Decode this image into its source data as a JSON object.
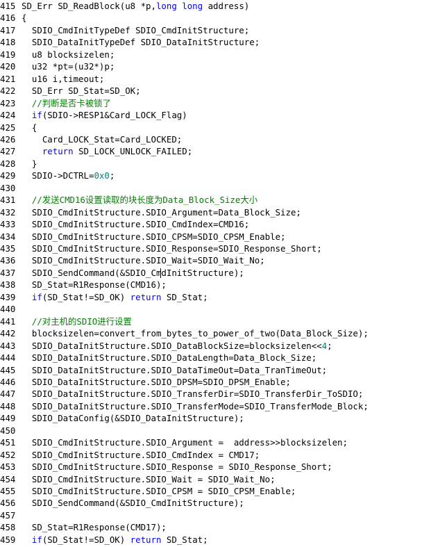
{
  "editor": {
    "lines": [
      {
        "no": "415",
        "parts": [
          {
            "t": "SD_Err SD_ReadBlock(u8 *p,"
          },
          {
            "t": "long long",
            "k": "kw"
          },
          {
            "t": " address)"
          }
        ]
      },
      {
        "no": "416",
        "parts": [
          {
            "t": "{"
          }
        ]
      },
      {
        "no": "417",
        "parts": [
          {
            "t": "  SDIO_CmdInitTypeDef SDIO_CmdInitStructure;"
          }
        ]
      },
      {
        "no": "418",
        "parts": [
          {
            "t": "  SDIO_DataInitTypeDef SDIO_DataInitStructure;"
          }
        ]
      },
      {
        "no": "419",
        "parts": [
          {
            "t": "  u8 blocksizelen;"
          }
        ]
      },
      {
        "no": "420",
        "parts": [
          {
            "t": "  u32 *pt=(u32*)p;"
          }
        ]
      },
      {
        "no": "421",
        "parts": [
          {
            "t": "  u16 i,timeout;"
          }
        ]
      },
      {
        "no": "422",
        "parts": [
          {
            "t": "  SD_Err SD_Stat=SD_OK;"
          }
        ]
      },
      {
        "no": "423",
        "parts": [
          {
            "t": "  //判断是否卡被锁了",
            "k": "cm"
          }
        ]
      },
      {
        "no": "424",
        "parts": [
          {
            "t": "  "
          },
          {
            "t": "if",
            "k": "kw"
          },
          {
            "t": "(SDIO->RESP1&Card_LOCK_Flag)"
          }
        ]
      },
      {
        "no": "425",
        "parts": [
          {
            "t": "  {"
          }
        ]
      },
      {
        "no": "426",
        "parts": [
          {
            "t": "    Card_LOCK_Stat=Card_LOCKED;"
          }
        ]
      },
      {
        "no": "427",
        "parts": [
          {
            "t": "    "
          },
          {
            "t": "return",
            "k": "kw"
          },
          {
            "t": " SD_LOCK_UNLOCK_FAILED;"
          }
        ]
      },
      {
        "no": "428",
        "parts": [
          {
            "t": "  }"
          }
        ]
      },
      {
        "no": "429",
        "parts": [
          {
            "t": "  SDIO->DCTRL="
          },
          {
            "t": "0x0",
            "k": "num"
          },
          {
            "t": ";"
          }
        ]
      },
      {
        "no": "430",
        "parts": []
      },
      {
        "no": "431",
        "parts": [
          {
            "t": "  //发送CMD16设置读取的块长度为Data_Block_Size大小",
            "k": "cm"
          }
        ]
      },
      {
        "no": "432",
        "parts": [
          {
            "t": "  SDIO_CmdInitStructure.SDIO_Argument=Data_Block_Size;"
          }
        ]
      },
      {
        "no": "433",
        "parts": [
          {
            "t": "  SDIO_CmdInitStructure.SDIO_CmdIndex=CMD16;"
          }
        ]
      },
      {
        "no": "434",
        "parts": [
          {
            "t": "  SDIO_CmdInitStructure.SDIO_CPSM=SDIO_CPSM_Enable;"
          }
        ]
      },
      {
        "no": "435",
        "parts": [
          {
            "t": "  SDIO_CmdInitStructure.SDIO_Response=SDIO_Response_Short;"
          }
        ]
      },
      {
        "no": "436",
        "parts": [
          {
            "t": "  SDIO_CmdInitStructure.SDIO_Wait=SDIO_Wait_No;"
          }
        ]
      },
      {
        "no": "437",
        "parts": [
          {
            "t": "  SDIO_SendCommand(&SDIO_CmdInitStructure);"
          }
        ]
      },
      {
        "no": "438",
        "parts": [
          {
            "t": "  SD_Stat=R1Response(CMD16);"
          }
        ]
      },
      {
        "no": "439",
        "parts": [
          {
            "t": "  "
          },
          {
            "t": "if",
            "k": "kw"
          },
          {
            "t": "(SD_Stat!=SD_OK) "
          },
          {
            "t": "return",
            "k": "kw"
          },
          {
            "t": " SD_Stat;"
          }
        ]
      },
      {
        "no": "440",
        "parts": []
      },
      {
        "no": "441",
        "parts": [
          {
            "t": "  //对主机的SDIO进行设置",
            "k": "cm"
          }
        ]
      },
      {
        "no": "442",
        "parts": [
          {
            "t": "  blocksizelen=convert_from_bytes_to_power_of_two(Data_Block_Size);"
          }
        ]
      },
      {
        "no": "443",
        "parts": [
          {
            "t": "  SDIO_DataInitStructure.SDIO_DataBlockSize=blocksizelen<<"
          },
          {
            "t": "4",
            "k": "num"
          },
          {
            "t": ";"
          }
        ]
      },
      {
        "no": "444",
        "parts": [
          {
            "t": "  SDIO_DataInitStructure.SDIO_DataLength=Data_Block_Size;"
          }
        ]
      },
      {
        "no": "445",
        "parts": [
          {
            "t": "  SDIO_DataInitStructure.SDIO_DataTimeOut=Data_TranTimeOut;"
          }
        ]
      },
      {
        "no": "446",
        "parts": [
          {
            "t": "  SDIO_DataInitStructure.SDIO_DPSM=SDIO_DPSM_Enable;"
          }
        ]
      },
      {
        "no": "447",
        "parts": [
          {
            "t": "  SDIO_DataInitStructure.SDIO_TransferDir=SDIO_TransferDir_ToSDIO;"
          }
        ]
      },
      {
        "no": "448",
        "parts": [
          {
            "t": "  SDIO_DataInitStructure.SDIO_TransferMode=SDIO_TransferMode_Block;"
          }
        ]
      },
      {
        "no": "449",
        "parts": [
          {
            "t": "  SDIO_DataConfig(&SDIO_DataInitStructure);"
          }
        ]
      },
      {
        "no": "450",
        "parts": []
      },
      {
        "no": "451",
        "parts": [
          {
            "t": "  SDIO_CmdInitStructure.SDIO_Argument =  address>>blocksizelen;"
          }
        ]
      },
      {
        "no": "452",
        "parts": [
          {
            "t": "  SDIO_CmdInitStructure.SDIO_CmdIndex = CMD17;"
          }
        ]
      },
      {
        "no": "453",
        "parts": [
          {
            "t": "  SDIO_CmdInitStructure.SDIO_Response = SDIO_Response_Short;"
          }
        ]
      },
      {
        "no": "454",
        "parts": [
          {
            "t": "  SDIO_CmdInitStructure.SDIO_Wait = SDIO_Wait_No;"
          }
        ]
      },
      {
        "no": "455",
        "parts": [
          {
            "t": "  SDIO_CmdInitStructure.SDIO_CPSM = SDIO_CPSM_Enable;"
          }
        ]
      },
      {
        "no": "456",
        "parts": [
          {
            "t": "  SDIO_SendCommand(&SDIO_CmdInitStructure);"
          }
        ]
      },
      {
        "no": "457",
        "parts": []
      },
      {
        "no": "458",
        "parts": [
          {
            "t": "  SD_Stat=R1Response(CMD17);"
          }
        ]
      },
      {
        "no": "459",
        "parts": [
          {
            "t": "  "
          },
          {
            "t": "if",
            "k": "kw"
          },
          {
            "t": "(SD_Stat!=SD_OK) "
          },
          {
            "t": "return",
            "k": "kw"
          },
          {
            "t": " SD_Stat;"
          }
        ]
      }
    ]
  },
  "colors": {
    "background": "#ffffff",
    "text": "#000000",
    "keyword": "#0000ff",
    "number": "#008080",
    "comment": "#008000"
  }
}
